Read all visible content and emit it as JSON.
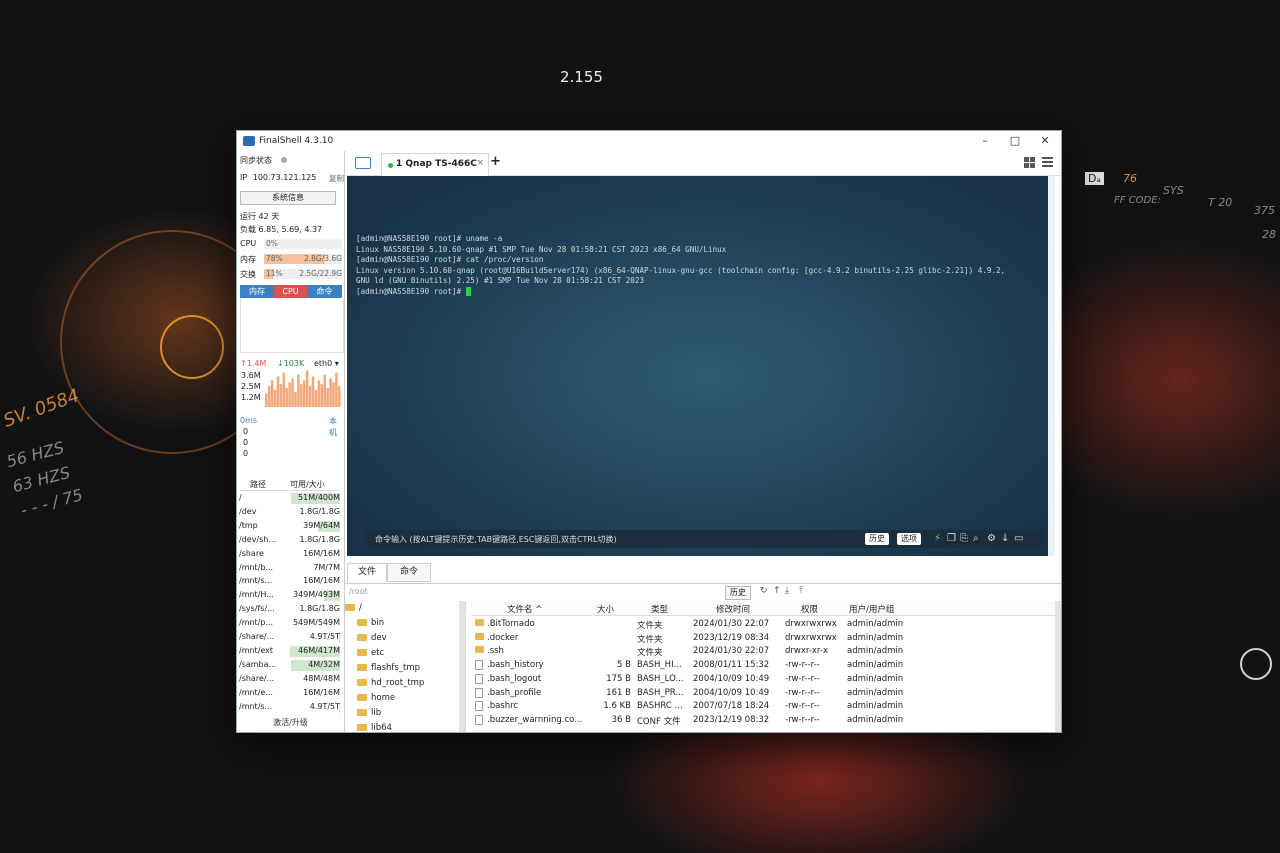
{
  "desktop": {
    "texts": [
      "2.155",
      "SV. 0584",
      "56 HZS",
      "63 HZS",
      "- - - / 75",
      "Dₐ",
      "76",
      "SYS",
      "T 20",
      "375",
      "FF CODE:",
      "28"
    ]
  },
  "window": {
    "app_title": "FinalShell 4.3.10",
    "controls": {
      "minimize": "–",
      "maximize": "□",
      "close": "✕"
    }
  },
  "sidebar": {
    "sync_label": "同步状态",
    "ip_label": "IP",
    "ip_value": "100.73.121.125",
    "copy_label": "复制",
    "sysinfo_button": "系统信息",
    "uptime": "运行 42 天",
    "load": "负载 6.85, 5.69, 4.37",
    "cpu": {
      "label": "CPU",
      "percent_text": "0%",
      "percent": 0
    },
    "mem": {
      "label": "内存",
      "percent_text": "78%",
      "percent": 78,
      "value": "2.8G/3.6G"
    },
    "swap": {
      "label": "交换",
      "percent_text": "11%",
      "percent": 11,
      "value": "2.5G/22.9G"
    },
    "monitor_tabs": [
      "内存",
      "CPU",
      "命令"
    ],
    "net": {
      "up": "↑1.4M",
      "down": "↓103K",
      "iface": "eth0 ▾",
      "levels": [
        "3.6M",
        "2.5M",
        "1.2M"
      ],
      "samples": [
        0.35,
        0.55,
        0.7,
        0.45,
        0.8,
        0.6,
        0.9,
        0.5,
        0.65,
        0.75,
        0.4,
        0.85,
        0.6,
        0.7,
        0.95,
        0.55,
        0.8,
        0.45,
        0.7,
        0.6,
        0.85,
        0.5,
        0.75,
        0.65,
        0.9,
        0.55
      ]
    },
    "ping": {
      "latency": "0ms",
      "local": "本机",
      "values": [
        "0",
        "0",
        "0"
      ]
    },
    "disk_header": {
      "path": "路径",
      "size": "可用/大小"
    },
    "disks": [
      {
        "path": "/",
        "size": "51M/400M",
        "used": 0.87
      },
      {
        "path": "/dev",
        "size": "1.8G/1.8G",
        "used": 0
      },
      {
        "path": "/tmp",
        "size": "39M/64M",
        "used": 0.39
      },
      {
        "path": "/dev/sh...",
        "size": "1.8G/1.8G",
        "used": 0
      },
      {
        "path": "/share",
        "size": "16M/16M",
        "used": 0
      },
      {
        "path": "/mnt/b...",
        "size": "7M/7M",
        "used": 0
      },
      {
        "path": "/mnt/s...",
        "size": "16M/16M",
        "used": 0
      },
      {
        "path": "/mnt/H...",
        "size": "349M/493M",
        "used": 0.29
      },
      {
        "path": "/sys/fs/...",
        "size": "1.8G/1.8G",
        "used": 0
      },
      {
        "path": "/mnt/p...",
        "size": "549M/549M",
        "used": 0
      },
      {
        "path": "/share/...",
        "size": "4.9T/5T",
        "used": 0.02
      },
      {
        "path": "/mnt/ext",
        "size": "46M/417M",
        "used": 0.89
      },
      {
        "path": "/samba...",
        "size": "4M/32M",
        "used": 0.88
      },
      {
        "path": "/share/...",
        "size": "48M/48M",
        "used": 0
      },
      {
        "path": "/mnt/e...",
        "size": "16M/16M",
        "used": 0
      },
      {
        "path": "/mnt/s...",
        "size": "4.9T/5T",
        "used": 0.02
      }
    ],
    "activate_label": "激活/升级"
  },
  "tabs": [
    {
      "label": "1 Qnap TS-466C",
      "close": "×"
    }
  ],
  "tab_add": "+",
  "terminal": {
    "lines": [
      "[admin@NAS58E190 root]# uname -a",
      "Linux NAS58E190 5.10.60-qnap #1 SMP Tue Nov 28 01:58:21 CST 2023 x86_64 GNU/Linux",
      "[admin@NAS58E190 root]# cat /proc/version",
      "Linux version 5.10.60-qnap (root@U16BuildServer174) (x86_64-QNAP-linux-gnu-gcc (toolchain config: [gcc-4.9.2 binutils-2.25 glibc-2.21]) 4.9.2,",
      "GNU ld (GNU Binutils) 2.25) #1 SMP Tue Nov 28 01:58:21 CST 2023"
    ],
    "prompt": "[admin@NAS58E190 root]# ",
    "cmd_hint": "命令输入 (按ALT键提示历史,TAB键路径,ESC键返回,双击CTRL切换)",
    "history_btn": "历史",
    "options_btn": "选项",
    "icons": [
      "⚡",
      "❐",
      "⎘",
      "⌕",
      "⚙",
      "↓",
      "▭"
    ]
  },
  "bottom": {
    "tabs": [
      "文件",
      "命令"
    ],
    "path": "/root",
    "history_btn": "历史",
    "tools": [
      "↻",
      "↑",
      "⤓",
      "⤒"
    ],
    "tree": [
      {
        "name": "/",
        "root": true
      },
      {
        "name": "bin"
      },
      {
        "name": "dev"
      },
      {
        "name": "etc"
      },
      {
        "name": "flashfs_tmp"
      },
      {
        "name": "hd_root_tmp"
      },
      {
        "name": "home"
      },
      {
        "name": "lib"
      },
      {
        "name": "lib64"
      }
    ],
    "columns": {
      "name": "文件名 ^",
      "size": "大小",
      "type": "类型",
      "modified": "修改时间",
      "perm": "权限",
      "owner": "用户/用户组"
    },
    "files": [
      {
        "name": ".BitTornado",
        "size": "",
        "type": "文件夹",
        "modified": "2024/01/30 22:07",
        "perm": "drwxrwxrwx",
        "owner": "admin/admin",
        "kind": "folder"
      },
      {
        "name": ".docker",
        "size": "",
        "type": "文件夹",
        "modified": "2023/12/19 08:34",
        "perm": "drwxrwxrwx",
        "owner": "admin/admin",
        "kind": "folder"
      },
      {
        "name": ".ssh",
        "size": "",
        "type": "文件夹",
        "modified": "2024/01/30 22:07",
        "perm": "drwxr-xr-x",
        "owner": "admin/admin",
        "kind": "folder"
      },
      {
        "name": ".bash_history",
        "size": "5 B",
        "type": "BASH_HI...",
        "modified": "2008/01/11 15:32",
        "perm": "-rw-r--r--",
        "owner": "admin/admin",
        "kind": "file"
      },
      {
        "name": ".bash_logout",
        "size": "175 B",
        "type": "BASH_LO...",
        "modified": "2004/10/09 10:49",
        "perm": "-rw-r--r--",
        "owner": "admin/admin",
        "kind": "file"
      },
      {
        "name": ".bash_profile",
        "size": "161 B",
        "type": "BASH_PR...",
        "modified": "2004/10/09 10:49",
        "perm": "-rw-r--r--",
        "owner": "admin/admin",
        "kind": "file"
      },
      {
        "name": ".bashrc",
        "size": "1.6 KB",
        "type": "BASHRC ...",
        "modified": "2007/07/18 18:24",
        "perm": "-rw-r--r--",
        "owner": "admin/admin",
        "kind": "file"
      },
      {
        "name": ".buzzer_warnning.co...",
        "size": "36 B",
        "type": "CONF 文件",
        "modified": "2023/12/19 08:32",
        "perm": "-rw-r--r--",
        "owner": "admin/admin",
        "kind": "file"
      }
    ]
  }
}
